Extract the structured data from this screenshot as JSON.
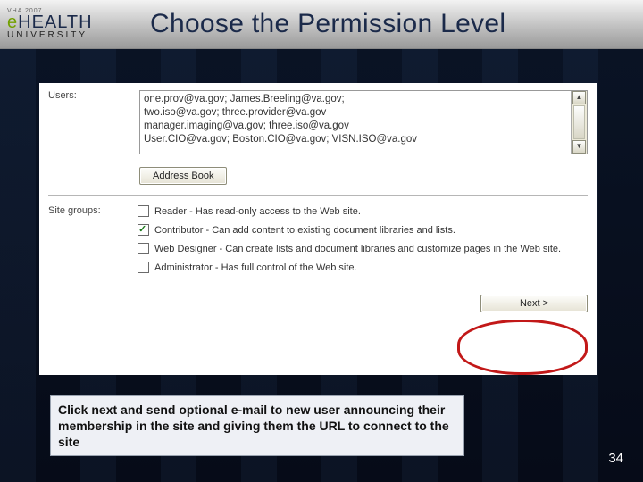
{
  "header": {
    "logo": {
      "top": "VHA 2007",
      "main_e": "e",
      "main_rest": "HEALTH",
      "sub": "UNIVERSITY"
    },
    "title": "Choose the Permission Level"
  },
  "form": {
    "users_label": "Users:",
    "users_text": "one.prov@va.gov; James.Breeling@va.gov;\ntwo.iso@va.gov; three.provider@va.gov\nmanager.imaging@va.gov; three.iso@va.gov\nUser.CIO@va.gov; Boston.CIO@va.gov; VISN.ISO@va.gov",
    "address_book_label": "Address Book",
    "groups_label": "Site groups:",
    "groups": [
      {
        "checked": false,
        "label": "Reader - Has read-only access to the Web site."
      },
      {
        "checked": true,
        "label": "Contributor - Can add content to existing document libraries and lists."
      },
      {
        "checked": false,
        "label": "Web Designer - Can create lists and document libraries and customize pages in the Web site."
      },
      {
        "checked": false,
        "label": "Administrator - Has full control of the Web site."
      }
    ],
    "next_label": "Next >"
  },
  "caption": "Click next and send optional e-mail to new user announcing their membership in the site and giving them the URL to connect to the site",
  "page_number": "34"
}
